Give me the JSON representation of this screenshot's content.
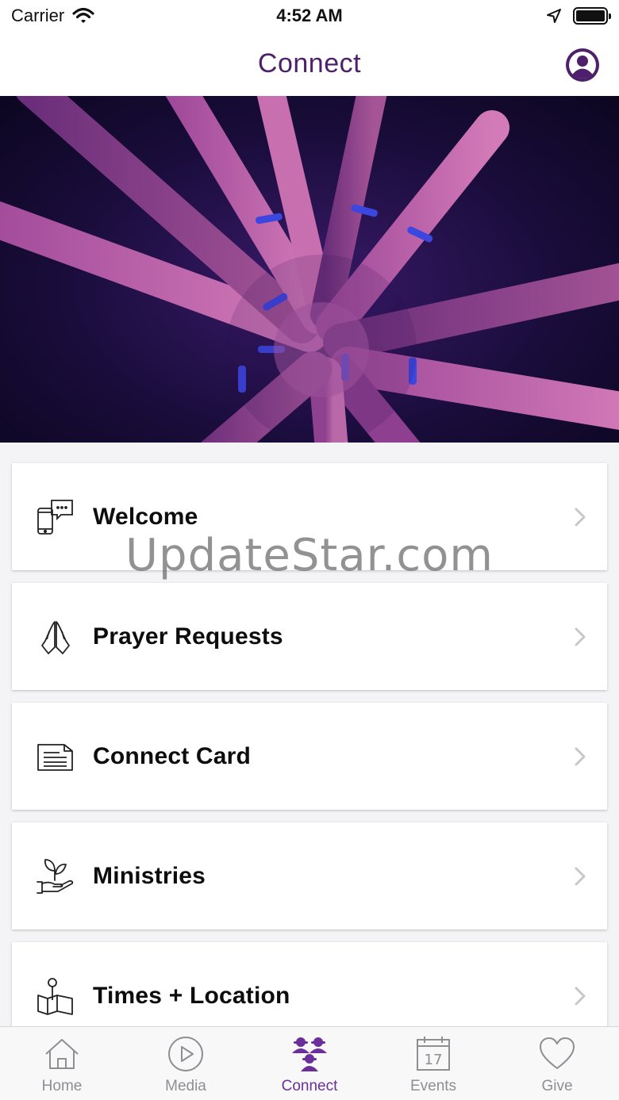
{
  "status_bar": {
    "carrier": "Carrier",
    "time": "4:52 AM"
  },
  "header": {
    "title": "Connect",
    "title_color": "#4e1f6b"
  },
  "menu": {
    "items": [
      {
        "label": "Welcome",
        "icon": "phone-chat-icon"
      },
      {
        "label": "Prayer Requests",
        "icon": "praying-hands-icon"
      },
      {
        "label": "Connect Card",
        "icon": "document-card-icon"
      },
      {
        "label": "Ministries",
        "icon": "hand-plant-icon"
      },
      {
        "label": "Times + Location",
        "icon": "map-pin-icon"
      }
    ]
  },
  "watermark": "UpdateStar.com",
  "tabbar": {
    "active_color": "#6a2f98",
    "items": [
      {
        "label": "Home",
        "icon": "home-icon"
      },
      {
        "label": "Media",
        "icon": "play-circle-icon"
      },
      {
        "label": "Connect",
        "icon": "people-group-icon"
      },
      {
        "label": "Events",
        "icon": "calendar-icon",
        "calendar_day": "17"
      },
      {
        "label": "Give",
        "icon": "heart-icon"
      }
    ]
  }
}
